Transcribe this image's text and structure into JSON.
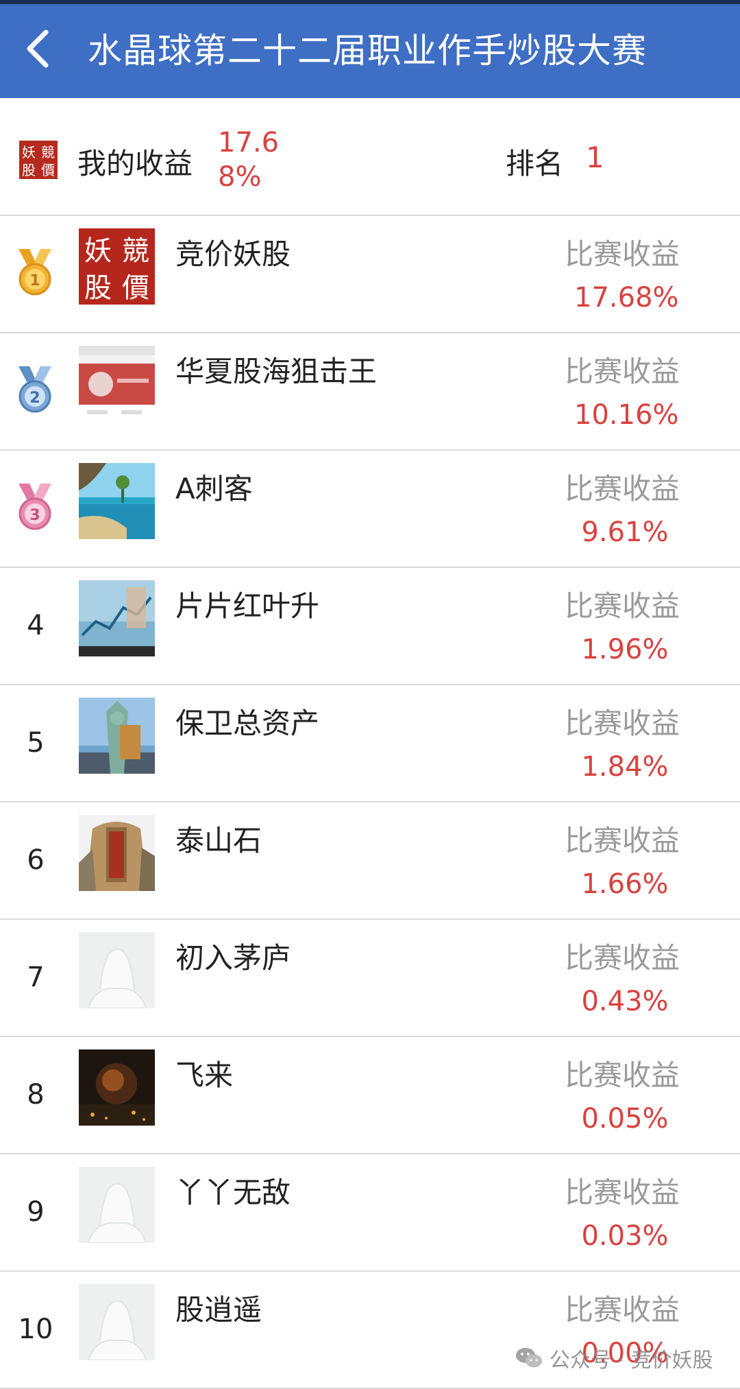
{
  "header": {
    "title": "水晶球第二十二届职业作手炒股大赛"
  },
  "my_summary": {
    "return_label": "我的收益",
    "return_value": "17.68%",
    "rank_label": "排名",
    "rank_value": "1",
    "avatar_text": [
      "妖",
      "競",
      "股",
      "價"
    ]
  },
  "metric_label": "比赛收益",
  "entries": [
    {
      "rank": "1",
      "name": "竞价妖股",
      "value": "17.68%"
    },
    {
      "rank": "2",
      "name": "华夏股海狙击王",
      "value": "10.16%"
    },
    {
      "rank": "3",
      "name": "A刺客",
      "value": "9.61%"
    },
    {
      "rank": "4",
      "name": "片片红叶升",
      "value": "1.96%"
    },
    {
      "rank": "5",
      "name": "保卫总资产",
      "value": "1.84%"
    },
    {
      "rank": "6",
      "name": "泰山石",
      "value": "1.66%"
    },
    {
      "rank": "7",
      "name": "初入茅庐",
      "value": "0.43%"
    },
    {
      "rank": "8",
      "name": "飞来",
      "value": "0.05%"
    },
    {
      "rank": "9",
      "name": "丫丫无敌",
      "value": "0.03%"
    },
    {
      "rank": "10",
      "name": "股逍遥",
      "value": "0.00%"
    }
  ],
  "watermark": {
    "text": "公众号 · 竞价妖股"
  },
  "colors": {
    "header": "#3f6fc4",
    "value_red": "#d9413f",
    "label_gray": "#9a9a9a",
    "gold": "#f2b233",
    "silver": "#7aa7d6",
    "bronze": "#e98bb0"
  }
}
